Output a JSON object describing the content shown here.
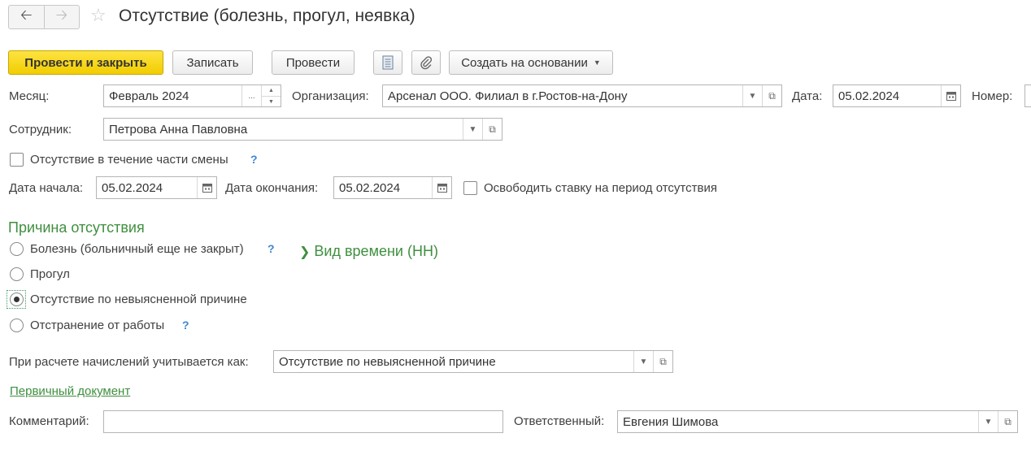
{
  "header": {
    "back_icon": "arrow-left-icon",
    "forward_icon": "arrow-right-icon",
    "favorite_icon": "star-icon",
    "title": "Отсутствие (болезнь, прогул, неявка)"
  },
  "toolbar": {
    "post_and_close": "Провести и закрыть",
    "save": "Записать",
    "post": "Провести",
    "create_based_on": "Создать на основании"
  },
  "form": {
    "month": {
      "label": "Месяц:",
      "value": "Февраль 2024"
    },
    "organization": {
      "label": "Организация:",
      "value": "Арсенал ООО. Филиал в г.Ростов-на-Дону"
    },
    "date": {
      "label": "Дата:",
      "value": "05.02.2024"
    },
    "number": {
      "label": "Номер:",
      "value": ""
    },
    "employee": {
      "label": "Сотрудник:",
      "value": "Петрова Анна Павловна"
    },
    "part_shift": {
      "label": "Отсутствие в течение части смены",
      "checked": false,
      "help": "?"
    },
    "date_start": {
      "label": "Дата начала:",
      "value": "05.02.2024"
    },
    "date_end": {
      "label": "Дата окончания:",
      "value": "05.02.2024"
    },
    "release_rate": {
      "label": "Освободить ставку на период отсутствия",
      "checked": false
    }
  },
  "reason": {
    "title": "Причина отсутствия",
    "options": [
      {
        "label": "Болезнь (больничный еще не закрыт)",
        "selected": false,
        "help": "?"
      },
      {
        "label": "Прогул",
        "selected": false
      },
      {
        "label": "Отсутствие по невыясненной причине",
        "selected": true
      },
      {
        "label": "Отстранение от работы",
        "selected": false,
        "help": "?"
      }
    ],
    "time_type": "Вид времени (НН)"
  },
  "accrual": {
    "label": "При расчете начислений учитывается как:",
    "value": "Отсутствие по невыясненной причине"
  },
  "primary_doc_link": "Первичный документ",
  "comment": {
    "label": "Комментарий:",
    "value": ""
  },
  "responsible": {
    "label": "Ответственный:",
    "value": "Евгения Шимова"
  },
  "colors": {
    "accent_green": "#3f8f3f",
    "primary_yellow": "#f2cd00",
    "help_blue": "#3b87d3"
  }
}
